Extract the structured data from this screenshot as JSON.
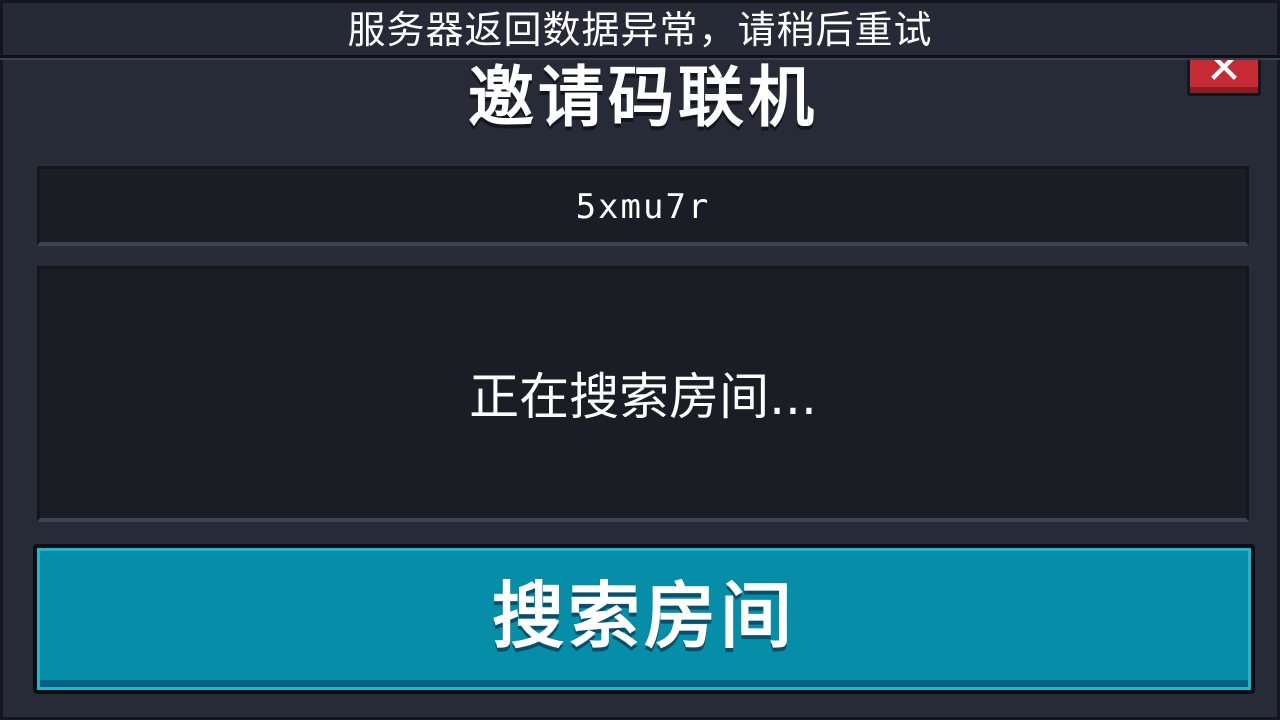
{
  "dialog": {
    "title": "邀请码联机",
    "close_icon": "close-icon"
  },
  "toast": {
    "message": "服务器返回数据异常，请稍后重试"
  },
  "invite_code": {
    "value": "5xmu7r"
  },
  "status": {
    "text": "正在搜索房间..."
  },
  "search_button": {
    "label": "搜索房间"
  },
  "colors": {
    "panel": "#272b37",
    "field": "#1b1d25",
    "button": "#068ea8",
    "close": "#c62a35",
    "text": "#ffffff"
  }
}
